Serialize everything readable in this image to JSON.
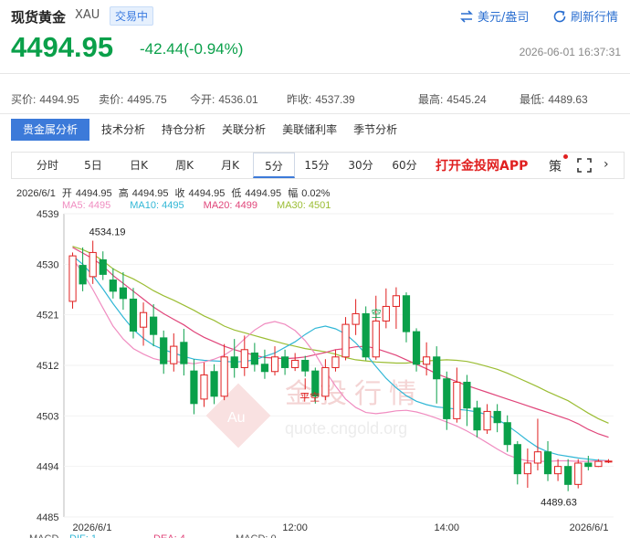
{
  "header": {
    "title": "现货黄金",
    "symbol": "XAU",
    "status": "交易中",
    "currency_button": "美元/盎司",
    "refresh_button": "刷新行情"
  },
  "quote": {
    "price": "4494.95",
    "change": "-42.44(-0.94%)",
    "timestamp": "2026-06-01 16:37:31",
    "color_down": "#0aa04a"
  },
  "stats": [
    {
      "label": "买价:",
      "value": "4494.95",
      "color": "#0aa04a"
    },
    {
      "label": "卖价:",
      "value": "4495.75",
      "color": "#0aa04a"
    },
    {
      "label": "今开:",
      "value": "4536.01",
      "color": "#0aa04a"
    },
    {
      "label": "昨收:",
      "value": "4537.39",
      "color": "#555555"
    },
    {
      "label": "最高:",
      "value": "4545.24",
      "color": "#e02020"
    },
    {
      "label": "最低:",
      "value": "4489.63",
      "color": "#0aa04a"
    }
  ],
  "tabs": [
    "贵金属分析",
    "技术分析",
    "持仓分析",
    "关联分析",
    "美联储利率",
    "季节分析"
  ],
  "periods": [
    "分时",
    "5日",
    "日K",
    "周K",
    "月K",
    "5分",
    "15分",
    "30分",
    "60分"
  ],
  "active_period": "5分",
  "app_link": "打开金投网APP",
  "toolbar_char": "策",
  "toolbar_chevron": "›",
  "bar_info": {
    "date": "2026/6/1",
    "open_label": "开",
    "open": "4494.95",
    "high_label": "高",
    "high": "4494.95",
    "close_label": "收",
    "close": "4494.95",
    "low_label": "低",
    "low": "4494.95",
    "amp_label": "幅",
    "amp": "0.02%"
  },
  "ma_legend": [
    {
      "label": "MA5: 4495",
      "color": "#f08cc0"
    },
    {
      "label": "MA10: 4495",
      "color": "#31b7d6"
    },
    {
      "label": "MA20: 4499",
      "color": "#e0457a"
    },
    {
      "label": "MA30: 4501",
      "color": "#9bbd33"
    }
  ],
  "chart_data": {
    "type": "candlestick",
    "y_ticks": [
      "4539",
      "4530",
      "4521",
      "4512",
      "4503",
      "4494",
      "4485"
    ],
    "x_ticks": [
      "2026/6/1",
      "12:00",
      "14:00",
      "2026/6/1"
    ],
    "ylim": [
      4485,
      4539
    ],
    "max_label": "4534.19",
    "min_label": "4489.63",
    "signal_labels": [
      "空",
      "平空"
    ],
    "watermark_text": "金投行情",
    "watermark_url": "quote.cngold.org",
    "watermark_logo": "Au",
    "indicator_labels": [
      "MACD",
      "DIF: 1",
      "DEA: 4",
      "MACD: 0"
    ],
    "colors": {
      "up": "#e02020",
      "down": "#0aa04a",
      "ma5": "#f08cc0",
      "ma10": "#31b7d6",
      "ma20": "#e0457a",
      "ma30": "#9bbd33"
    },
    "ma30": [
      4533.2,
      4532.6,
      4531.8,
      4530.6,
      4529.2,
      4528.2,
      4527.4,
      4526.4,
      4525.3,
      4524.4,
      4523.6,
      4522.7,
      4521.8,
      4520.8,
      4520.0,
      4519.0,
      4518.3,
      4517.8,
      4517.3,
      4516.8,
      4516.3,
      4515.8,
      4515.4,
      4515.0,
      4514.7,
      4514.4,
      4514.0,
      4513.4,
      4513.0,
      4512.8,
      4512.6,
      4512.5,
      4512.4,
      4512.4,
      4512.6,
      4512.8,
      4512.9,
      4513.0,
      4512.9,
      4512.7,
      4512.3,
      4511.8,
      4511.3,
      4510.6,
      4509.8,
      4509.0,
      4508.2,
      4507.3,
      4506.5,
      4505.7,
      4504.6,
      4503.5,
      4502.5,
      4501.7
    ],
    "ma20": [
      4533.0,
      4532.0,
      4531.0,
      4529.7,
      4528.0,
      4526.6,
      4525.2,
      4523.8,
      4522.4,
      4521.2,
      4520.2,
      4519.2,
      4518.0,
      4517.0,
      4516.2,
      4515.4,
      4514.8,
      4514.3,
      4513.8,
      4513.4,
      4513.3,
      4513.2,
      4513.3,
      4513.5,
      4513.9,
      4514.3,
      4514.8,
      4515.0,
      4515.3,
      4515.4,
      4515.0,
      4514.4,
      4513.8,
      4513.0,
      4512.2,
      4511.4,
      4510.5,
      4509.8,
      4509.1,
      4508.4,
      4507.8,
      4507.2,
      4506.6,
      4506.0,
      4505.4,
      4504.8,
      4504.2,
      4503.6,
      4503.0,
      4502.4,
      4501.6,
      4500.6,
      4499.8,
      4499.2
    ],
    "ma10": [
      4531.5,
      4530.0,
      4528.0,
      4525.6,
      4523.0,
      4520.6,
      4518.4,
      4516.8,
      4515.6,
      4514.8,
      4514.2,
      4513.6,
      4513.1,
      4512.9,
      4512.8,
      4512.7,
      4512.6,
      4512.7,
      4513.0,
      4513.6,
      4514.2,
      4515.2,
      4516.2,
      4517.5,
      4518.6,
      4519.0,
      4518.5,
      4517.6,
      4516.0,
      4514.0,
      4511.8,
      4509.7,
      4508.0,
      4506.6,
      4505.6,
      4505.0,
      4504.6,
      4504.4,
      4504.2,
      4504.0,
      4503.7,
      4503.2,
      4502.4,
      4501.3,
      4500.0,
      4498.6,
      4497.4,
      4496.6,
      4496.1,
      4495.8,
      4495.5,
      4495.3,
      4495.1,
      4495.0
    ],
    "ma5": [
      4531.0,
      4528.5,
      4525.5,
      4522.2,
      4519.0,
      4516.7,
      4515.0,
      4514.0,
      4513.2,
      4512.8,
      4512.7,
      4512.5,
      4512.3,
      4512.6,
      4513.1,
      4513.8,
      4515.0,
      4516.7,
      4518.3,
      4519.4,
      4519.8,
      4519.3,
      4518.2,
      4516.4,
      4514.0,
      4511.0,
      4508.3,
      4506.0,
      4504.5,
      4503.6,
      4503.4,
      4503.6,
      4503.9,
      4504.0,
      4503.7,
      4503.2,
      4502.6,
      4501.9,
      4501.2,
      4500.3,
      4499.3,
      4498.2,
      4497.1,
      4496.1,
      4495.4,
      4495.0,
      4494.9,
      4494.9,
      4495.0,
      4495.0,
      4494.9,
      4494.9,
      4495.0,
      4495.0
    ],
    "candles": [
      [
        4523.4,
        4531.5,
        4532.1,
        4522.1
      ],
      [
        4529.8,
        4526.5,
        4533.0,
        4525.2
      ],
      [
        4527.8,
        4532.1,
        4534.2,
        4526.5
      ],
      [
        4530.8,
        4528.2,
        4532.3,
        4527.2
      ],
      [
        4527.2,
        4525.2,
        4529.3,
        4523.9
      ],
      [
        4525.8,
        4523.9,
        4528.6,
        4521.9
      ],
      [
        4523.8,
        4518.1,
        4525.8,
        4516.8
      ],
      [
        4518.8,
        4521.4,
        4523.2,
        4515.5
      ],
      [
        4520.6,
        4517.5,
        4522.9,
        4515.4
      ],
      [
        4516.9,
        4512.3,
        4518.2,
        4510.5
      ],
      [
        4512.3,
        4515.4,
        4517.7,
        4510.9
      ],
      [
        4516.1,
        4512.3,
        4518.5,
        4510.2
      ],
      [
        4511.0,
        4505.2,
        4513.1,
        4503.3
      ],
      [
        4506.0,
        4510.3,
        4512.5,
        4504.6
      ],
      [
        4510.9,
        4506.5,
        4512.2,
        4505.1
      ],
      [
        4506.5,
        4513.5,
        4515.8,
        4505.8
      ],
      [
        4513.5,
        4511.6,
        4516.7,
        4509.8
      ],
      [
        4511.6,
        4514.8,
        4517.3,
        4510.1
      ],
      [
        4514.2,
        4512.2,
        4516.0,
        4510.9
      ],
      [
        4512.2,
        4510.9,
        4514.8,
        4509.6
      ],
      [
        4510.9,
        4513.5,
        4515.4,
        4510.2
      ],
      [
        4513.5,
        4511.6,
        4514.8,
        4510.3
      ],
      [
        4511.6,
        4512.9,
        4514.2,
        4511.0
      ],
      [
        4512.9,
        4511.0,
        4513.7,
        4510.0
      ],
      [
        4511.0,
        4506.5,
        4511.6,
        4505.2
      ],
      [
        4506.5,
        4511.6,
        4513.1,
        4505.8
      ],
      [
        4511.6,
        4513.5,
        4514.8,
        4510.9
      ],
      [
        4513.5,
        4519.3,
        4520.6,
        4512.9
      ],
      [
        4519.3,
        4521.2,
        4523.8,
        4517.4
      ],
      [
        4521.2,
        4513.5,
        4522.5,
        4512.9
      ],
      [
        4513.5,
        4519.9,
        4524.4,
        4513.0
      ],
      [
        4519.9,
        4522.5,
        4525.7,
        4518.6
      ],
      [
        4522.5,
        4524.4,
        4525.9,
        4518.5
      ],
      [
        4524.4,
        4518.0,
        4525.0,
        4516.1
      ],
      [
        4518.0,
        4512.2,
        4518.6,
        4510.9
      ],
      [
        4512.2,
        4513.5,
        4516.1,
        4510.2
      ],
      [
        4513.5,
        4509.6,
        4515.4,
        4505.2
      ],
      [
        4509.6,
        4502.5,
        4510.9,
        4500.5
      ],
      [
        4502.5,
        4509.0,
        4511.6,
        4501.8
      ],
      [
        4509.0,
        4504.4,
        4510.3,
        4501.2
      ],
      [
        4504.4,
        4500.5,
        4505.7,
        4499.2
      ],
      [
        4500.5,
        4503.8,
        4505.1,
        4499.8
      ],
      [
        4503.8,
        4501.8,
        4505.1,
        4500.1
      ],
      [
        4501.8,
        4497.9,
        4503.1,
        4496.6
      ],
      [
        4497.9,
        4492.7,
        4498.5,
        4490.8
      ],
      [
        4492.7,
        4494.6,
        4497.2,
        4490.2
      ],
      [
        4494.6,
        4496.6,
        4502.5,
        4493.3
      ],
      [
        4496.6,
        4492.7,
        4498.5,
        4491.4
      ],
      [
        4492.7,
        4494.0,
        4495.3,
        4491.4
      ],
      [
        4494.0,
        4490.8,
        4495.3,
        4489.6
      ],
      [
        4490.8,
        4494.6,
        4495.3,
        4490.1
      ],
      [
        4494.6,
        4494.0,
        4495.9,
        4493.3
      ],
      [
        4494.0,
        4494.9,
        4495.3,
        4493.9
      ],
      [
        4494.9,
        4494.95,
        4495.3,
        4494.6
      ]
    ]
  }
}
